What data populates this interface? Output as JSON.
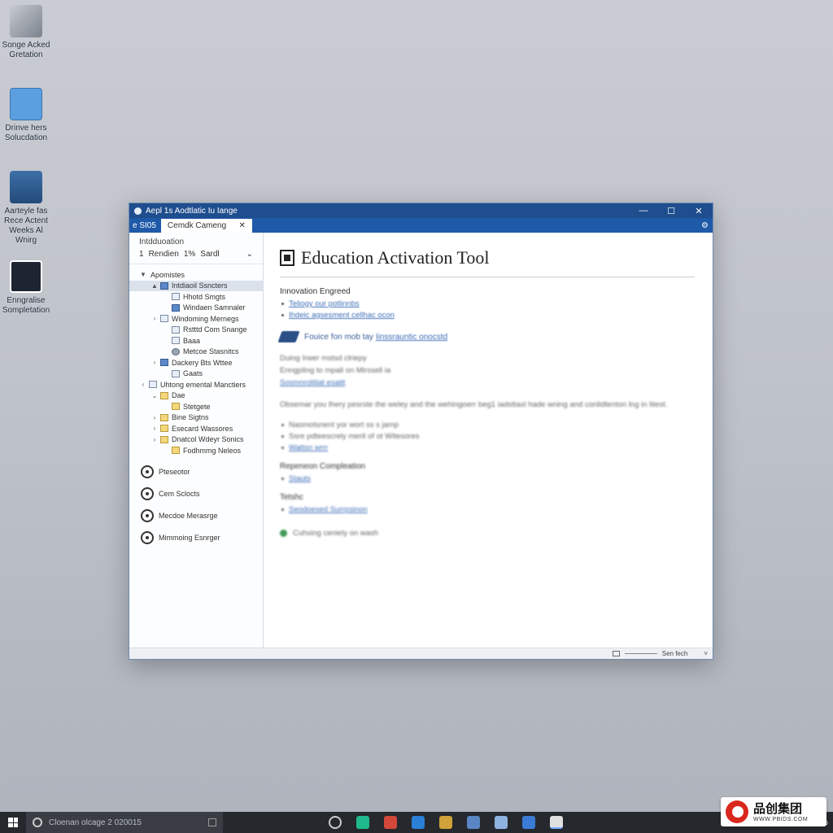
{
  "desktop": {
    "icons": [
      {
        "label": "Songe Acked Gretation",
        "icon": "installer-icon"
      },
      {
        "label": "Drinve hers Solucdation",
        "icon": "folder-icon"
      },
      {
        "label": "Aarteyle fas Rece Actent Weeks Al Wnirg",
        "icon": "user-photo-icon"
      },
      {
        "label": "Enngralise Sompletation",
        "icon": "certificate-icon"
      }
    ]
  },
  "window": {
    "title": "Aepl 1s Aodtlatic Iu Iange",
    "tab_small": "e SI05",
    "tab_active": "Cemdk Cameng",
    "tab_close": "✕",
    "controls": {
      "minimize": "—",
      "maximize": "☐",
      "close": "✕",
      "settings": "⚙"
    }
  },
  "sidebar": {
    "header": "Intdduoation",
    "toolbar": {
      "num1": "1",
      "render": "Rendien",
      "num2": "1%",
      "search": "Sardl",
      "dropdown": "⌄"
    },
    "tree": [
      {
        "label": "Apomistes",
        "toggle": "▼",
        "indent": 0,
        "icon": "none"
      },
      {
        "label": "Intdiaoil Ssncters",
        "toggle": "▲",
        "indent": 1,
        "icon": "blue",
        "selected": true
      },
      {
        "label": "Hhotd Smgts",
        "toggle": "",
        "indent": 2,
        "icon": "file"
      },
      {
        "label": "Windaen Samnaler",
        "toggle": "",
        "indent": 2,
        "icon": "blue"
      },
      {
        "label": "Windoming Mernegs",
        "toggle": "›",
        "indent": 1,
        "icon": "file"
      },
      {
        "label": "Rstttd Com Snange",
        "toggle": "",
        "indent": 2,
        "icon": "file"
      },
      {
        "label": "Baaa",
        "toggle": "",
        "indent": 2,
        "icon": "file"
      },
      {
        "label": "Metcoe Stasnitcs",
        "toggle": "",
        "indent": 2,
        "icon": "gear"
      },
      {
        "label": "Dackery Bts Wttee",
        "toggle": "›",
        "indent": 1,
        "icon": "blue"
      },
      {
        "label": "Gaats",
        "toggle": "",
        "indent": 2,
        "icon": "file"
      },
      {
        "label": "Uhtong emental Manctiers",
        "toggle": "‹",
        "indent": 0,
        "icon": "file"
      },
      {
        "label": "Dae",
        "toggle": "⌄",
        "indent": 1,
        "icon": "folder"
      },
      {
        "label": "Stetgete",
        "toggle": "",
        "indent": 2,
        "icon": "folder"
      },
      {
        "label": "Bine Sigtns",
        "toggle": "›",
        "indent": 1,
        "icon": "folder"
      },
      {
        "label": "Esecard Wassores",
        "toggle": "›",
        "indent": 1,
        "icon": "folder"
      },
      {
        "label": "Dnatcol Wdeyr Sonics",
        "toggle": "›",
        "indent": 1,
        "icon": "folder"
      },
      {
        "label": "Fodhmmg Neleos",
        "toggle": "",
        "indent": 2,
        "icon": "folder"
      }
    ],
    "actions": [
      {
        "label": "Pteseotor",
        "icon": "dial-icon"
      },
      {
        "label": "Cem Sclocts",
        "icon": "globe-icon"
      },
      {
        "label": "Mecdoe Merasrge",
        "icon": "gear-icon"
      },
      {
        "label": "Mimmoing Esnrger",
        "icon": "dial-icon"
      }
    ]
  },
  "main": {
    "title": "Education Activation Tool",
    "section1": {
      "label": "Innovation Engreed",
      "links": [
        "Teliogy our potlinnbs",
        "Ihdeic agsesment cellhac ocon"
      ]
    },
    "promo": {
      "text": "Fouice fon mob tay",
      "link": "Iinssrauntic onocstd"
    },
    "section2": {
      "lines": [
        "Duing Irwer mstsd clriepy",
        "Enngpling to mpali on Mirssell ia"
      ],
      "link": "Sosmnrolitiat esaitt"
    },
    "paragraph": "Obsemar you Ihery pesrste the weley and the wehingoerr beg1 iadsttaxl hade wning and conlidtenton lng in litest.",
    "section3": {
      "bullets": [
        "Nasmotsnent yor wort ss s jamp",
        "Ssre pdteescrely merit of ot Witesores",
        "Wattsn wrrr"
      ]
    },
    "section4": {
      "label": "Repeneon Compleation",
      "link": "Stauts"
    },
    "section5": {
      "label": "Tetshc",
      "link": "Seodoesed Surrpsinon"
    },
    "status": "Cuhsing ceniely on wash"
  },
  "statusbar": {
    "text": "Sen fech",
    "arrow": "˅"
  },
  "taskbar": {
    "search_placeholder": "Cloenan olcage 2 020015",
    "apps": [
      {
        "icon": "cortana-icon",
        "color": "#25282d"
      },
      {
        "icon": "app-green-icon",
        "color": "#1fb98e"
      },
      {
        "icon": "pinwheel-icon",
        "color": "#d4473b"
      },
      {
        "icon": "store-icon",
        "color": "#2a7fd6"
      },
      {
        "icon": "photo-icon",
        "color": "#d0a23a"
      },
      {
        "icon": "paint-icon",
        "color": "#5a86c5"
      },
      {
        "icon": "home-icon",
        "color": "#8fb3e0"
      },
      {
        "icon": "mail-icon",
        "color": "#3a7bd5"
      },
      {
        "icon": "chrome-icon",
        "color": "#e0e0e0"
      }
    ],
    "tray_left": "↗",
    "tray_mid": "ω"
  },
  "watermark": {
    "cn": "品创集团",
    "url": "WWW.PBIDS.COM"
  }
}
